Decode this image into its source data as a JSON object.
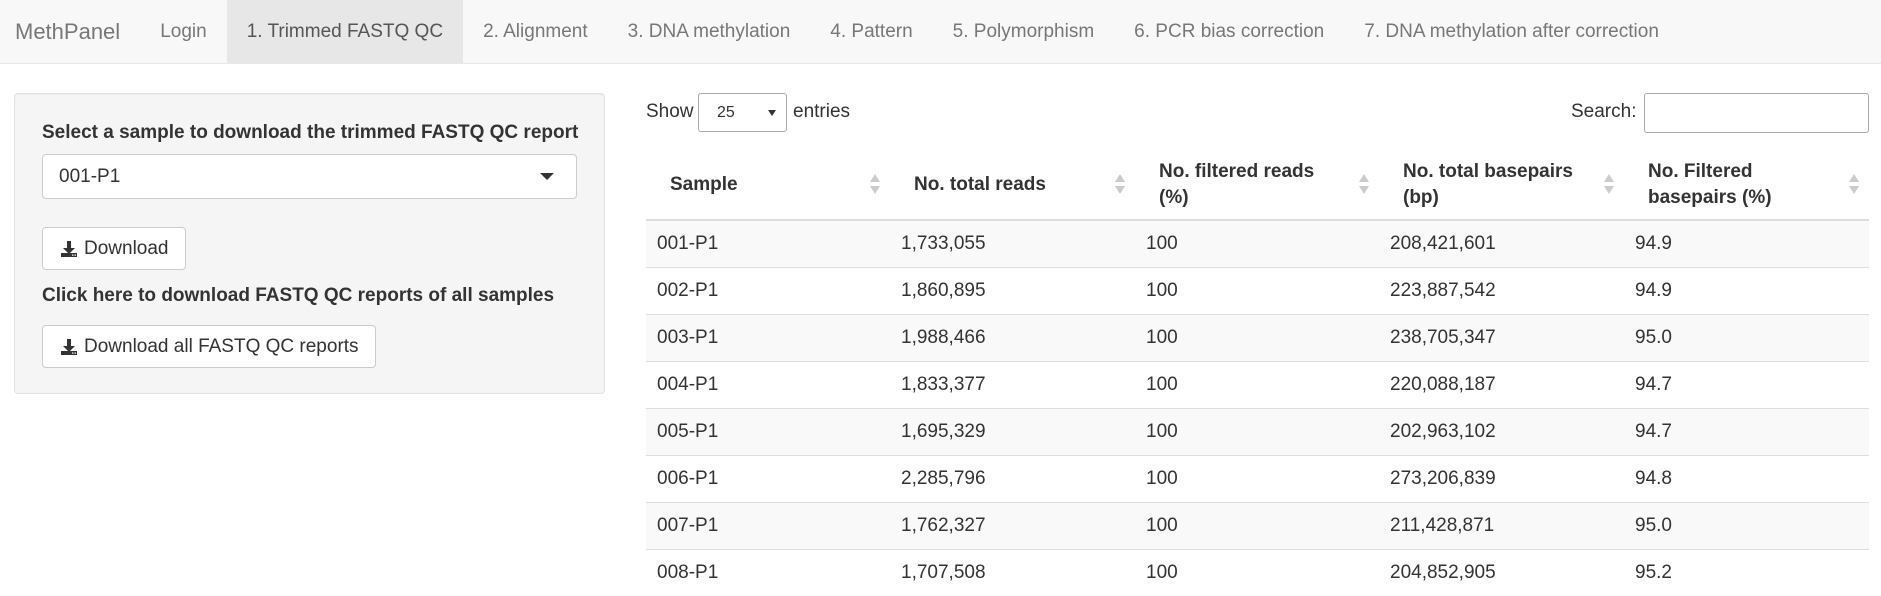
{
  "navbar": {
    "brand": "MethPanel",
    "tabs": [
      {
        "label": "Login",
        "active": false
      },
      {
        "label": "1. Trimmed FASTQ QC",
        "active": true
      },
      {
        "label": "2. Alignment",
        "active": false
      },
      {
        "label": "3. DNA methylation",
        "active": false
      },
      {
        "label": "4. Pattern",
        "active": false
      },
      {
        "label": "5. Polymorphism",
        "active": false
      },
      {
        "label": "6. PCR bias correction",
        "active": false
      },
      {
        "label": "7. DNA methylation after correction",
        "active": false
      }
    ]
  },
  "sidebar": {
    "select_label": "Select a sample to download the trimmed FASTQ QC report",
    "selected_sample": "001-P1",
    "download_label": "Download",
    "all_label": "Click here to download FASTQ QC reports of all samples",
    "download_all_label": "Download all FASTQ QC reports"
  },
  "table": {
    "show_label": "Show",
    "entries_value": "25",
    "entries_label": "entries",
    "search_label": "Search:",
    "search_value": "",
    "headers": [
      "Sample",
      "No. total reads",
      "No. filtered reads (%)",
      "No. total basepairs (bp)",
      "No. Filtered basepairs (%)"
    ],
    "rows": [
      [
        "001-P1",
        "1,733,055",
        "100",
        "208,421,601",
        "94.9"
      ],
      [
        "002-P1",
        "1,860,895",
        "100",
        "223,887,542",
        "94.9"
      ],
      [
        "003-P1",
        "1,988,466",
        "100",
        "238,705,347",
        "95.0"
      ],
      [
        "004-P1",
        "1,833,377",
        "100",
        "220,088,187",
        "94.7"
      ],
      [
        "005-P1",
        "1,695,329",
        "100",
        "202,963,102",
        "94.7"
      ],
      [
        "006-P1",
        "2,285,796",
        "100",
        "273,206,839",
        "94.8"
      ],
      [
        "007-P1",
        "1,762,327",
        "100",
        "211,428,871",
        "95.0"
      ],
      [
        "008-P1",
        "1,707,508",
        "100",
        "204,852,905",
        "95.2"
      ]
    ]
  }
}
